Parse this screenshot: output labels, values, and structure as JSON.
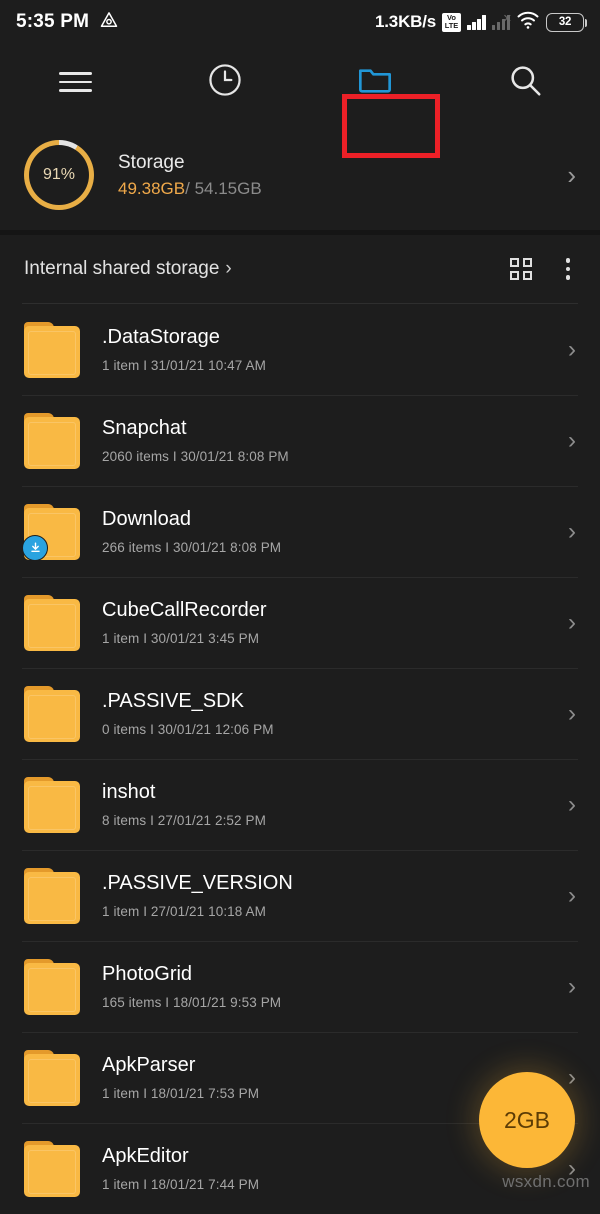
{
  "status_bar": {
    "time": "5:35 PM",
    "alert_icon": "triangle-alert-icon",
    "network_speed": "1.3KB/s",
    "volte_top": "Vo",
    "volte_bottom": "LTE",
    "battery_level": "32"
  },
  "toolbar": {
    "menu_icon": "hamburger-menu-icon",
    "recent_icon": "clock-recent-icon",
    "files_icon": "folder-icon",
    "search_icon": "search-icon",
    "highlight_color": "#ec2027",
    "active_tab_color": "#2196d6"
  },
  "storage": {
    "percent": "91%",
    "percent_value": 91,
    "title": "Storage",
    "used": "49.38GB",
    "separator": "/ ",
    "total": "54.15GB",
    "chevron": "›",
    "accent_color": "#e8ae45"
  },
  "breadcrumb": {
    "label": "Internal shared storage",
    "arrow": "›",
    "grid_view_icon": "grid-view-icon",
    "overflow_icon": "more-vertical-icon"
  },
  "files": [
    {
      "name": ".DataStorage",
      "meta": "1 item  I  31/01/21 10:47 AM",
      "badge": "none"
    },
    {
      "name": "Snapchat",
      "meta": "2060 items  I  30/01/21 8:08 PM",
      "badge": "none"
    },
    {
      "name": "Download",
      "meta": "266 items  I  30/01/21 8:08 PM",
      "badge": "download"
    },
    {
      "name": "CubeCallRecorder",
      "meta": "1 item  I  30/01/21 3:45 PM",
      "badge": "none"
    },
    {
      "name": ".PASSIVE_SDK",
      "meta": "0 items  I  30/01/21 12:06 PM",
      "badge": "none"
    },
    {
      "name": "inshot",
      "meta": "8 items  I  27/01/21 2:52 PM",
      "badge": "none"
    },
    {
      "name": ".PASSIVE_VERSION",
      "meta": "1 item  I  27/01/21 10:18 AM",
      "badge": "none"
    },
    {
      "name": "PhotoGrid",
      "meta": "165 items  I  18/01/21 9:53 PM",
      "badge": "none"
    },
    {
      "name": "ApkParser",
      "meta": "1 item  I  18/01/21 7:53 PM",
      "badge": "none"
    },
    {
      "name": "ApkEditor",
      "meta": "1 item  I  18/01/21 7:44 PM",
      "badge": "none"
    }
  ],
  "row_chevron": "›",
  "fab": {
    "label": "2GB",
    "color": "#fcb737"
  },
  "watermark": {
    "text": "wsxdn.com"
  }
}
